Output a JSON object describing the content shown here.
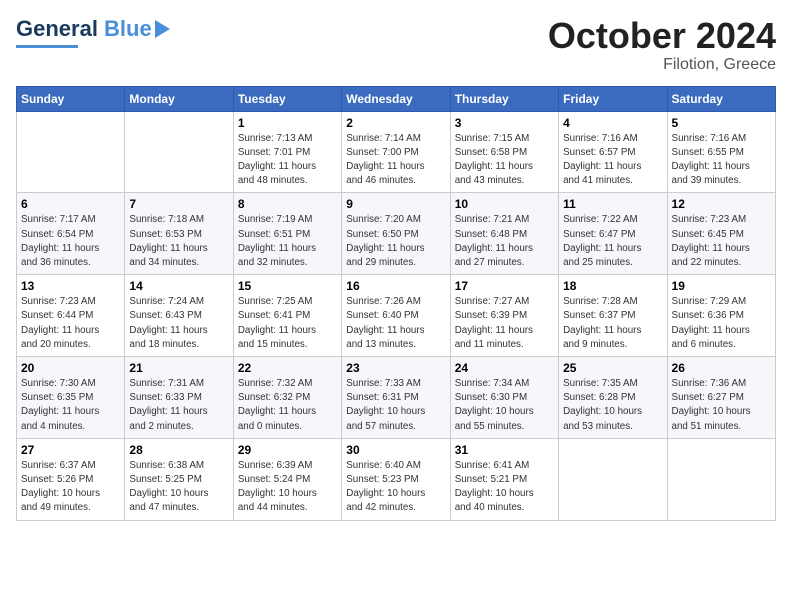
{
  "header": {
    "logo_line1": "General",
    "logo_line2": "Blue",
    "month": "October 2024",
    "location": "Filotion, Greece"
  },
  "weekdays": [
    "Sunday",
    "Monday",
    "Tuesday",
    "Wednesday",
    "Thursday",
    "Friday",
    "Saturday"
  ],
  "weeks": [
    [
      {
        "num": "",
        "info": ""
      },
      {
        "num": "",
        "info": ""
      },
      {
        "num": "1",
        "info": "Sunrise: 7:13 AM\nSunset: 7:01 PM\nDaylight: 11 hours\nand 48 minutes."
      },
      {
        "num": "2",
        "info": "Sunrise: 7:14 AM\nSunset: 7:00 PM\nDaylight: 11 hours\nand 46 minutes."
      },
      {
        "num": "3",
        "info": "Sunrise: 7:15 AM\nSunset: 6:58 PM\nDaylight: 11 hours\nand 43 minutes."
      },
      {
        "num": "4",
        "info": "Sunrise: 7:16 AM\nSunset: 6:57 PM\nDaylight: 11 hours\nand 41 minutes."
      },
      {
        "num": "5",
        "info": "Sunrise: 7:16 AM\nSunset: 6:55 PM\nDaylight: 11 hours\nand 39 minutes."
      }
    ],
    [
      {
        "num": "6",
        "info": "Sunrise: 7:17 AM\nSunset: 6:54 PM\nDaylight: 11 hours\nand 36 minutes."
      },
      {
        "num": "7",
        "info": "Sunrise: 7:18 AM\nSunset: 6:53 PM\nDaylight: 11 hours\nand 34 minutes."
      },
      {
        "num": "8",
        "info": "Sunrise: 7:19 AM\nSunset: 6:51 PM\nDaylight: 11 hours\nand 32 minutes."
      },
      {
        "num": "9",
        "info": "Sunrise: 7:20 AM\nSunset: 6:50 PM\nDaylight: 11 hours\nand 29 minutes."
      },
      {
        "num": "10",
        "info": "Sunrise: 7:21 AM\nSunset: 6:48 PM\nDaylight: 11 hours\nand 27 minutes."
      },
      {
        "num": "11",
        "info": "Sunrise: 7:22 AM\nSunset: 6:47 PM\nDaylight: 11 hours\nand 25 minutes."
      },
      {
        "num": "12",
        "info": "Sunrise: 7:23 AM\nSunset: 6:45 PM\nDaylight: 11 hours\nand 22 minutes."
      }
    ],
    [
      {
        "num": "13",
        "info": "Sunrise: 7:23 AM\nSunset: 6:44 PM\nDaylight: 11 hours\nand 20 minutes."
      },
      {
        "num": "14",
        "info": "Sunrise: 7:24 AM\nSunset: 6:43 PM\nDaylight: 11 hours\nand 18 minutes."
      },
      {
        "num": "15",
        "info": "Sunrise: 7:25 AM\nSunset: 6:41 PM\nDaylight: 11 hours\nand 15 minutes."
      },
      {
        "num": "16",
        "info": "Sunrise: 7:26 AM\nSunset: 6:40 PM\nDaylight: 11 hours\nand 13 minutes."
      },
      {
        "num": "17",
        "info": "Sunrise: 7:27 AM\nSunset: 6:39 PM\nDaylight: 11 hours\nand 11 minutes."
      },
      {
        "num": "18",
        "info": "Sunrise: 7:28 AM\nSunset: 6:37 PM\nDaylight: 11 hours\nand 9 minutes."
      },
      {
        "num": "19",
        "info": "Sunrise: 7:29 AM\nSunset: 6:36 PM\nDaylight: 11 hours\nand 6 minutes."
      }
    ],
    [
      {
        "num": "20",
        "info": "Sunrise: 7:30 AM\nSunset: 6:35 PM\nDaylight: 11 hours\nand 4 minutes."
      },
      {
        "num": "21",
        "info": "Sunrise: 7:31 AM\nSunset: 6:33 PM\nDaylight: 11 hours\nand 2 minutes."
      },
      {
        "num": "22",
        "info": "Sunrise: 7:32 AM\nSunset: 6:32 PM\nDaylight: 11 hours\nand 0 minutes."
      },
      {
        "num": "23",
        "info": "Sunrise: 7:33 AM\nSunset: 6:31 PM\nDaylight: 10 hours\nand 57 minutes."
      },
      {
        "num": "24",
        "info": "Sunrise: 7:34 AM\nSunset: 6:30 PM\nDaylight: 10 hours\nand 55 minutes."
      },
      {
        "num": "25",
        "info": "Sunrise: 7:35 AM\nSunset: 6:28 PM\nDaylight: 10 hours\nand 53 minutes."
      },
      {
        "num": "26",
        "info": "Sunrise: 7:36 AM\nSunset: 6:27 PM\nDaylight: 10 hours\nand 51 minutes."
      }
    ],
    [
      {
        "num": "27",
        "info": "Sunrise: 6:37 AM\nSunset: 5:26 PM\nDaylight: 10 hours\nand 49 minutes."
      },
      {
        "num": "28",
        "info": "Sunrise: 6:38 AM\nSunset: 5:25 PM\nDaylight: 10 hours\nand 47 minutes."
      },
      {
        "num": "29",
        "info": "Sunrise: 6:39 AM\nSunset: 5:24 PM\nDaylight: 10 hours\nand 44 minutes."
      },
      {
        "num": "30",
        "info": "Sunrise: 6:40 AM\nSunset: 5:23 PM\nDaylight: 10 hours\nand 42 minutes."
      },
      {
        "num": "31",
        "info": "Sunrise: 6:41 AM\nSunset: 5:21 PM\nDaylight: 10 hours\nand 40 minutes."
      },
      {
        "num": "",
        "info": ""
      },
      {
        "num": "",
        "info": ""
      }
    ]
  ]
}
